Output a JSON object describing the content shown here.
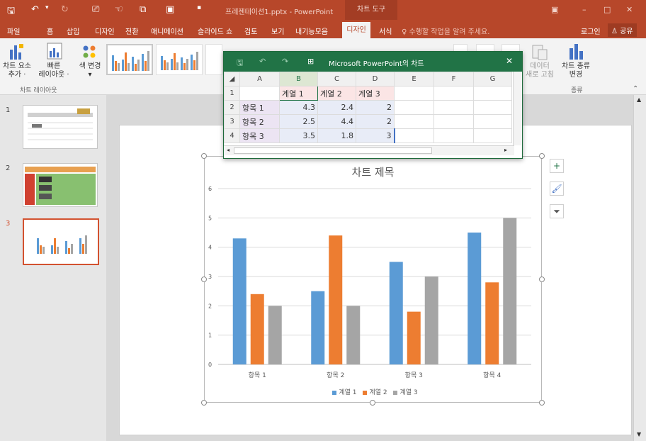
{
  "window": {
    "title": "프레젠테이션1.pptx - PowerPoint",
    "context_tab": "차트 도구"
  },
  "tabs": [
    {
      "label": "파일"
    },
    {
      "label": "홈"
    },
    {
      "label": "삽입"
    },
    {
      "label": "디자인"
    },
    {
      "label": "전환"
    },
    {
      "label": "애니메이션"
    },
    {
      "label": "슬라이드 쇼"
    },
    {
      "label": "검토"
    },
    {
      "label": "보기"
    },
    {
      "label": "내기능모음"
    }
  ],
  "active_tab": "디자인",
  "format_tab": "서식",
  "tell_me": "수행할 작업을 알려 주세요.",
  "login": "로그인",
  "share": "공유",
  "ribbon": {
    "add_element": "차트 요소",
    "add_element2": "추가 ·",
    "quick_layout": "빠른",
    "quick_layout2": "레이아웃 ·",
    "change_color": "색 변경",
    "group_layout": "차트 레이아웃",
    "refresh_data": "데이터",
    "refresh_data2": "새로 고침",
    "change_type": "차트 종류",
    "change_type2": "변경",
    "group_type": "종류"
  },
  "slides": [
    {
      "num": "1"
    },
    {
      "num": "2"
    },
    {
      "num": "3"
    }
  ],
  "sheet": {
    "title": "Microsoft PowerPoint의 차트",
    "columns": [
      "A",
      "B",
      "C",
      "D",
      "E",
      "F",
      "G"
    ],
    "rows": [
      "1",
      "2",
      "3",
      "4"
    ],
    "header_row": [
      "",
      "계열 1",
      "계열 2",
      "계열 3"
    ],
    "data_rows": [
      [
        "항목 1",
        "4.3",
        "2.4",
        "2"
      ],
      [
        "항목 2",
        "2.5",
        "4.4",
        "2"
      ],
      [
        "항목 3",
        "3.5",
        "1.8",
        "3"
      ]
    ]
  },
  "chart_data": {
    "type": "bar",
    "title": "차트 제목",
    "categories": [
      "항목 1",
      "항목 2",
      "항목 3",
      "항목 4"
    ],
    "series": [
      {
        "name": "계열 1",
        "values": [
          4.3,
          2.5,
          3.5,
          4.5
        ],
        "color": "#5b9bd5"
      },
      {
        "name": "계열 2",
        "values": [
          2.4,
          4.4,
          1.8,
          2.8
        ],
        "color": "#ed7d31"
      },
      {
        "name": "계열 3",
        "values": [
          2,
          2,
          3,
          5
        ],
        "color": "#a5a5a5"
      }
    ],
    "ylim": [
      0,
      6
    ],
    "yticks": [
      "0",
      "1",
      "2",
      "3",
      "4",
      "5",
      "6"
    ],
    "grid": true,
    "legend": "bottom"
  },
  "colors": {
    "accent": "#b7472a",
    "excel": "#217346"
  }
}
